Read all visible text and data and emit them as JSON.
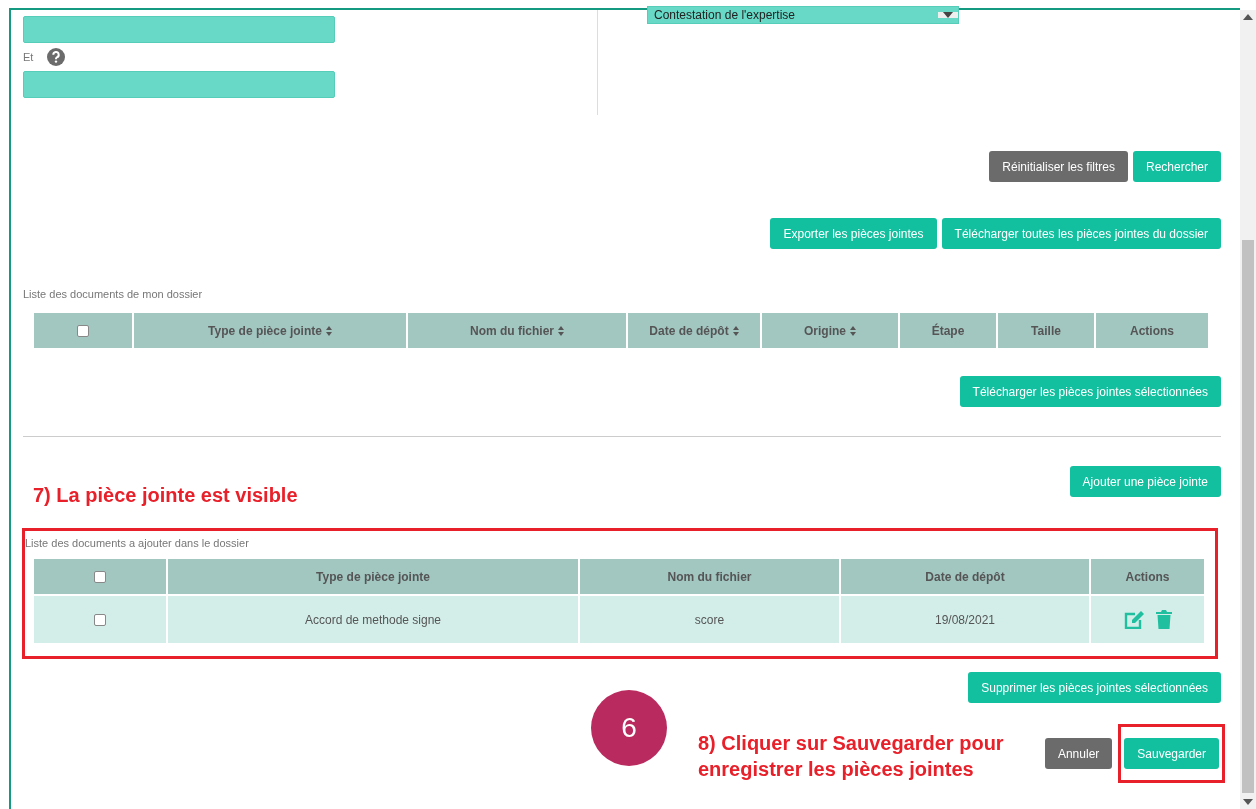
{
  "filter_fields": [
    {
      "kind": "field"
    },
    {
      "kind": "labeled_field",
      "label": "Et",
      "help": true
    }
  ],
  "select": {
    "value": "Contestation de l'expertise"
  },
  "filter_buttons": [
    {
      "label": "Réinitialiser les filtres",
      "kind": "secondary"
    },
    {
      "label": "Rechercher",
      "kind": "primary"
    }
  ],
  "export_buttons": [
    {
      "label": "Exporter les pièces jointes",
      "kind": "primary"
    },
    {
      "label": "Télécharger toutes les pièces jointes du dossier",
      "kind": "primary"
    }
  ],
  "my_documents": {
    "caption": "Liste des documents de mon dossier",
    "header_checkbox": {
      "checked": false
    },
    "columns": [
      {
        "label": "Type de pièce jointe",
        "sortable": true
      },
      {
        "label": "Nom du fichier",
        "sortable": true
      },
      {
        "label": "Date de dépôt",
        "sortable": true
      },
      {
        "label": "Origine",
        "sortable": true
      },
      {
        "label": "Étape",
        "sortable": false
      },
      {
        "label": "Taille",
        "sortable": false
      },
      {
        "label": "Actions",
        "sortable": false
      }
    ],
    "download_button": "Télécharger les pièces jointes sélectionnées"
  },
  "add_button": "Ajouter une pièce jointe",
  "documents_to_add": {
    "caption": "Liste des documents a ajouter dans le dossier",
    "highlighted": true,
    "header_checkbox": {
      "checked": false
    },
    "columns": [
      {
        "label": "Type de pièce jointe"
      },
      {
        "label": "Nom du fichier"
      },
      {
        "label": "Date de dépôt"
      },
      {
        "label": "Actions"
      }
    ],
    "rows": [
      {
        "checked": false,
        "cells": [
          "Accord de methode signe",
          "score",
          "19/08/2021"
        ]
      }
    ],
    "delete_button": "Supprimer les pièces jointes sélectionnées"
  },
  "footer_buttons": [
    {
      "label": "Annuler",
      "kind": "secondary",
      "highlighted": false
    },
    {
      "label": "Sauvegarder",
      "kind": "primary",
      "highlighted": true
    }
  ],
  "annotations": [
    {
      "kind": "caption",
      "text": "7) La pièce jointe est visible"
    },
    {
      "kind": "step_badge",
      "text": "6"
    },
    {
      "kind": "caption",
      "text": "8) Cliquer sur Sauvegarder pour enregistrer les pièces jointes"
    }
  ]
}
